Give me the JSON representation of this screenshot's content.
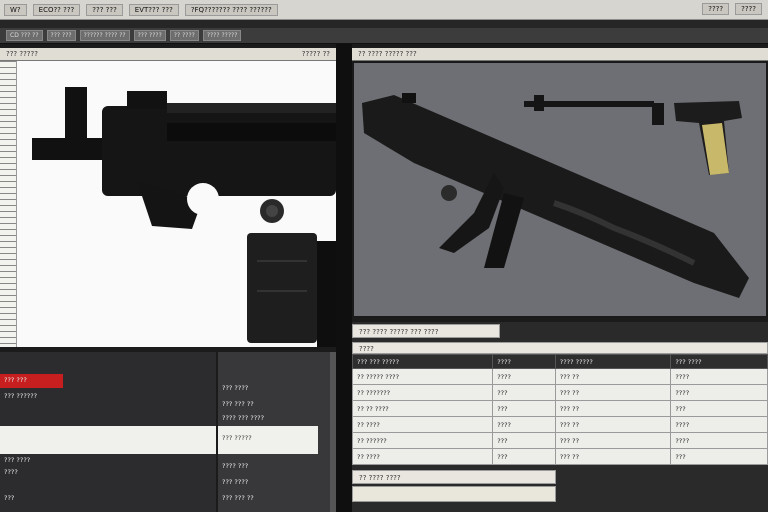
{
  "menubar": {
    "items": [
      "W?",
      "ECO?? ???",
      "??? ???",
      "EVT??? ???",
      "?FQ??????? ???? ??????"
    ],
    "right_items": [
      "????",
      "????"
    ]
  },
  "toolbar": {
    "items": [
      "CD ??? ??",
      "??? ???",
      "?????? ???? ??",
      "??? ????",
      "?? ????",
      "???? ?????"
    ]
  },
  "left_view": {
    "header": "??? ?????",
    "header_right": "????? ??"
  },
  "right_view": {
    "header": "?? ???? ????? ???",
    "background_color": "#6e6f74"
  },
  "left_list": {
    "rows": [
      "??? ???",
      "??? ??????",
      "??? ????",
      "????",
      "???"
    ],
    "highlight_color": "#c71f1f"
  },
  "mid_list": {
    "rows": [
      "??? ????",
      "??? ??? ??",
      "???? ??? ????",
      "??? ?????",
      "???? ???",
      "??? ????",
      "??? ??? ??"
    ]
  },
  "table": {
    "title": "??? ???? ????? ??? ????",
    "subtitle": "????",
    "columns": [
      "??? ??? ?????",
      "????",
      "???? ?????",
      "??? ????"
    ],
    "rows": [
      [
        "?? ????? ????",
        "????",
        "??? ??",
        "????"
      ],
      [
        "?? ???????",
        "???",
        "??? ??",
        "????"
      ],
      [
        "?? ?? ????",
        "???",
        "??? ??",
        "???"
      ],
      [
        "?? ????",
        "????",
        "??? ??",
        "????"
      ],
      [
        "?? ??????",
        "???",
        "??? ??",
        "????"
      ],
      [
        "?? ????",
        "???",
        "??? ??",
        "???"
      ]
    ],
    "footer": "?? ???? ????"
  },
  "colors": {
    "accent_olive": "#505a26",
    "alert_red": "#c71f1f",
    "grip_gold": "#c8b86a"
  }
}
